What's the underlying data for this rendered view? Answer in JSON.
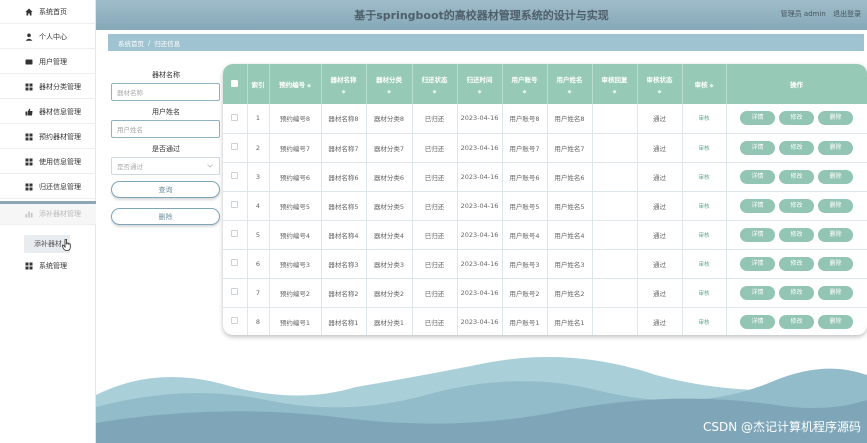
{
  "sidebar": {
    "items": [
      {
        "label": "系统首页",
        "icon": "home-icon"
      },
      {
        "label": "个人中心",
        "icon": "user-icon"
      },
      {
        "label": "用户管理",
        "icon": "card-icon"
      },
      {
        "label": "器材分类管理",
        "icon": "grid-icon"
      },
      {
        "label": "器材信息管理",
        "icon": "thumb-icon"
      },
      {
        "label": "预约器材管理",
        "icon": "grid-icon"
      },
      {
        "label": "使用信息管理",
        "icon": "grid-icon"
      },
      {
        "label": "归还信息管理",
        "icon": "grid-icon"
      },
      {
        "label": "添补器材管理",
        "icon": "bar-chart-icon"
      },
      {
        "label": "系统管理",
        "icon": "grid-icon"
      }
    ],
    "sub_item": "添补器材"
  },
  "header": {
    "title": "基于springboot的高校器材管理系统的设计与实现",
    "user_label": "管理员 admin",
    "logout_label": "退出登录"
  },
  "breadcrumb": {
    "home": "系统首页",
    "separator": "/",
    "current": "归还信息"
  },
  "search": {
    "equipment_name_label": "器材名称",
    "equipment_name_placeholder": "器材名称",
    "user_name_label": "用户姓名",
    "user_name_placeholder": "用户姓名",
    "passed_label": "是否通过",
    "passed_placeholder": "是否通过",
    "query_button": "查询",
    "delete_button": "删除"
  },
  "table": {
    "columns": [
      "索引",
      "预约编号",
      "器材名称",
      "器材分类",
      "归还状态",
      "归还时间",
      "用户账号",
      "用户姓名",
      "审核回复",
      "审核状态",
      "审核",
      "操作"
    ],
    "sort_mark": "◆",
    "rows": [
      {
        "index": "1",
        "booking_no": "预约编号8",
        "name": "器材名称8",
        "category": "器材分类8",
        "return_status": "已归还",
        "return_time": "2023-04-16",
        "account": "用户账号8",
        "user_name": "用户姓名8",
        "reply": "",
        "audit_status": "通过",
        "audit": "审核"
      },
      {
        "index": "2",
        "booking_no": "预约编号7",
        "name": "器材名称7",
        "category": "器材分类7",
        "return_status": "已归还",
        "return_time": "2023-04-16",
        "account": "用户账号7",
        "user_name": "用户姓名7",
        "reply": "",
        "audit_status": "通过",
        "audit": "审核"
      },
      {
        "index": "3",
        "booking_no": "预约编号6",
        "name": "器材名称6",
        "category": "器材分类6",
        "return_status": "已归还",
        "return_time": "2023-04-16",
        "account": "用户账号6",
        "user_name": "用户姓名6",
        "reply": "",
        "audit_status": "通过",
        "audit": "审核"
      },
      {
        "index": "4",
        "booking_no": "预约编号5",
        "name": "器材名称5",
        "category": "器材分类5",
        "return_status": "已归还",
        "return_time": "2023-04-16",
        "account": "用户账号5",
        "user_name": "用户姓名5",
        "reply": "",
        "audit_status": "通过",
        "audit": "审核"
      },
      {
        "index": "5",
        "booking_no": "预约编号4",
        "name": "器材名称4",
        "category": "器材分类4",
        "return_status": "已归还",
        "return_time": "2023-04-16",
        "account": "用户账号4",
        "user_name": "用户姓名4",
        "reply": "",
        "audit_status": "通过",
        "audit": "审核"
      },
      {
        "index": "6",
        "booking_no": "预约编号3",
        "name": "器材名称3",
        "category": "器材分类3",
        "return_status": "已归还",
        "return_time": "2023-04-16",
        "account": "用户账号3",
        "user_name": "用户姓名3",
        "reply": "",
        "audit_status": "通过",
        "audit": "审核"
      },
      {
        "index": "7",
        "booking_no": "预约编号2",
        "name": "器材名称2",
        "category": "器材分类2",
        "return_status": "已归还",
        "return_time": "2023-04-16",
        "account": "用户账号2",
        "user_name": "用户姓名2",
        "reply": "",
        "audit_status": "通过",
        "audit": "审核"
      },
      {
        "index": "8",
        "booking_no": "预约编号1",
        "name": "器材名称1",
        "category": "器材分类1",
        "return_status": "已归还",
        "return_time": "2023-04-16",
        "account": "用户账号1",
        "user_name": "用户姓名1",
        "reply": "",
        "audit_status": "通过",
        "audit": "审核"
      }
    ],
    "actions": {
      "detail": "详情",
      "edit": "修改",
      "delete": "删除"
    }
  },
  "watermark": "CSDN @杰记计算机程序源码",
  "colors": {
    "header": "#8fb0bf",
    "breadcrumb": "#9fc3d0",
    "table_header": "#96c9b6",
    "action_button": "#92c5b3",
    "wave_dark": "#7ea6b8",
    "wave_light": "#a9cfd9"
  }
}
